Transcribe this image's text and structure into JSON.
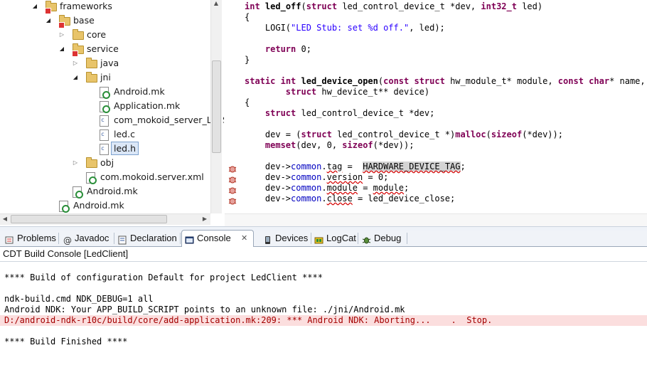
{
  "tree": {
    "items": [
      {
        "label": "frameworks",
        "depth": 0,
        "state": "open",
        "icon": "package-folder-icon"
      },
      {
        "label": "base",
        "depth": 1,
        "state": "open",
        "icon": "package-folder-icon"
      },
      {
        "label": "core",
        "depth": 2,
        "state": "closed",
        "icon": "folder-icon"
      },
      {
        "label": "service",
        "depth": 2,
        "state": "open",
        "icon": "package-folder-icon"
      },
      {
        "label": "java",
        "depth": 3,
        "state": "closed",
        "icon": "folder-icon"
      },
      {
        "label": "jni",
        "depth": 3,
        "state": "open",
        "icon": "folder-icon"
      },
      {
        "label": "Android.mk",
        "depth": 4,
        "state": "leaf",
        "icon": "makefile-icon"
      },
      {
        "label": "Application.mk",
        "depth": 4,
        "state": "leaf",
        "icon": "makefile-icon"
      },
      {
        "label": "com_mokoid_server_LedSe",
        "depth": 4,
        "state": "leaf",
        "icon": "c-source-file-icon"
      },
      {
        "label": "led.c",
        "depth": 4,
        "state": "leaf",
        "icon": "c-source-file-icon"
      },
      {
        "label": "led.h",
        "depth": 4,
        "state": "leaf",
        "icon": "c-header-file-icon",
        "selected": true
      },
      {
        "label": "obj",
        "depth": 3,
        "state": "closed",
        "icon": "folder-icon"
      },
      {
        "label": "com.mokoid.server.xml",
        "depth": 3,
        "state": "leaf",
        "icon": "xml-file-icon"
      },
      {
        "label": "Android.mk",
        "depth": 2,
        "state": "leaf",
        "icon": "makefile-icon"
      },
      {
        "label": "Android.mk",
        "depth": 1,
        "state": "leaf",
        "icon": "makefile-icon"
      }
    ]
  },
  "editor": {
    "lines": [
      "int led_off(struct led_control_device_t *dev, int32_t led)",
      "{",
      "    LOGI(\"LED Stub: set %d off.\", led);",
      "",
      "    return 0;",
      "}",
      "",
      "static int led_device_open(const struct hw_module_t* module, const char* name,",
      "        struct hw_device_t** device)",
      "{",
      "    struct led_control_device_t *dev;",
      "",
      "    dev = (struct led_control_device_t *)malloc(sizeof(*dev));",
      "    memset(dev, 0, sizeof(*dev));",
      "",
      "    dev->common.tag =  HARDWARE_DEVICE_TAG;",
      "    dev->common.version = 0;",
      "    dev->common.module = module;",
      "    dev->common.close = led_device_close;"
    ],
    "warning_marker_icon": "bug-warning-icon"
  },
  "tabs": [
    {
      "label": "Problems",
      "icon": "problems-icon",
      "active": false
    },
    {
      "label": "Javadoc",
      "icon": "at-sign-icon",
      "active": false
    },
    {
      "label": "Declaration",
      "icon": "declaration-icon",
      "active": false
    },
    {
      "label": "Console",
      "icon": "console-icon",
      "active": true,
      "close": "✕"
    },
    {
      "label": "Devices",
      "icon": "phone-icon",
      "active": false
    },
    {
      "label": "LogCat",
      "icon": "logcat-icon",
      "active": false
    },
    {
      "label": "Debug",
      "icon": "bug-icon",
      "active": false
    }
  ],
  "console": {
    "title": "CDT Build Console [LedClient]",
    "lines": [
      {
        "text": "",
        "type": "normal"
      },
      {
        "text": "**** Build of configuration Default for project LedClient ****",
        "type": "normal"
      },
      {
        "text": "",
        "type": "normal"
      },
      {
        "text": "ndk-build.cmd NDK_DEBUG=1 all",
        "type": "normal"
      },
      {
        "text": "Android NDK: Your APP_BUILD_SCRIPT points to an unknown file: ./jni/Android.mk",
        "type": "normal"
      },
      {
        "text": "D:/android-ndk-r10c/build/core/add-application.mk:209: *** Android NDK: Aborting...    .  Stop.",
        "type": "error"
      },
      {
        "text": "",
        "type": "normal"
      },
      {
        "text": "**** Build Finished ****",
        "type": "normal"
      }
    ]
  },
  "colors": {
    "keyword": "#7f0055",
    "string": "#2a00ff",
    "field": "#0000c0",
    "error_bg": "#fbdede",
    "error_text": "#a40000",
    "selection": "#dbe7f7"
  }
}
